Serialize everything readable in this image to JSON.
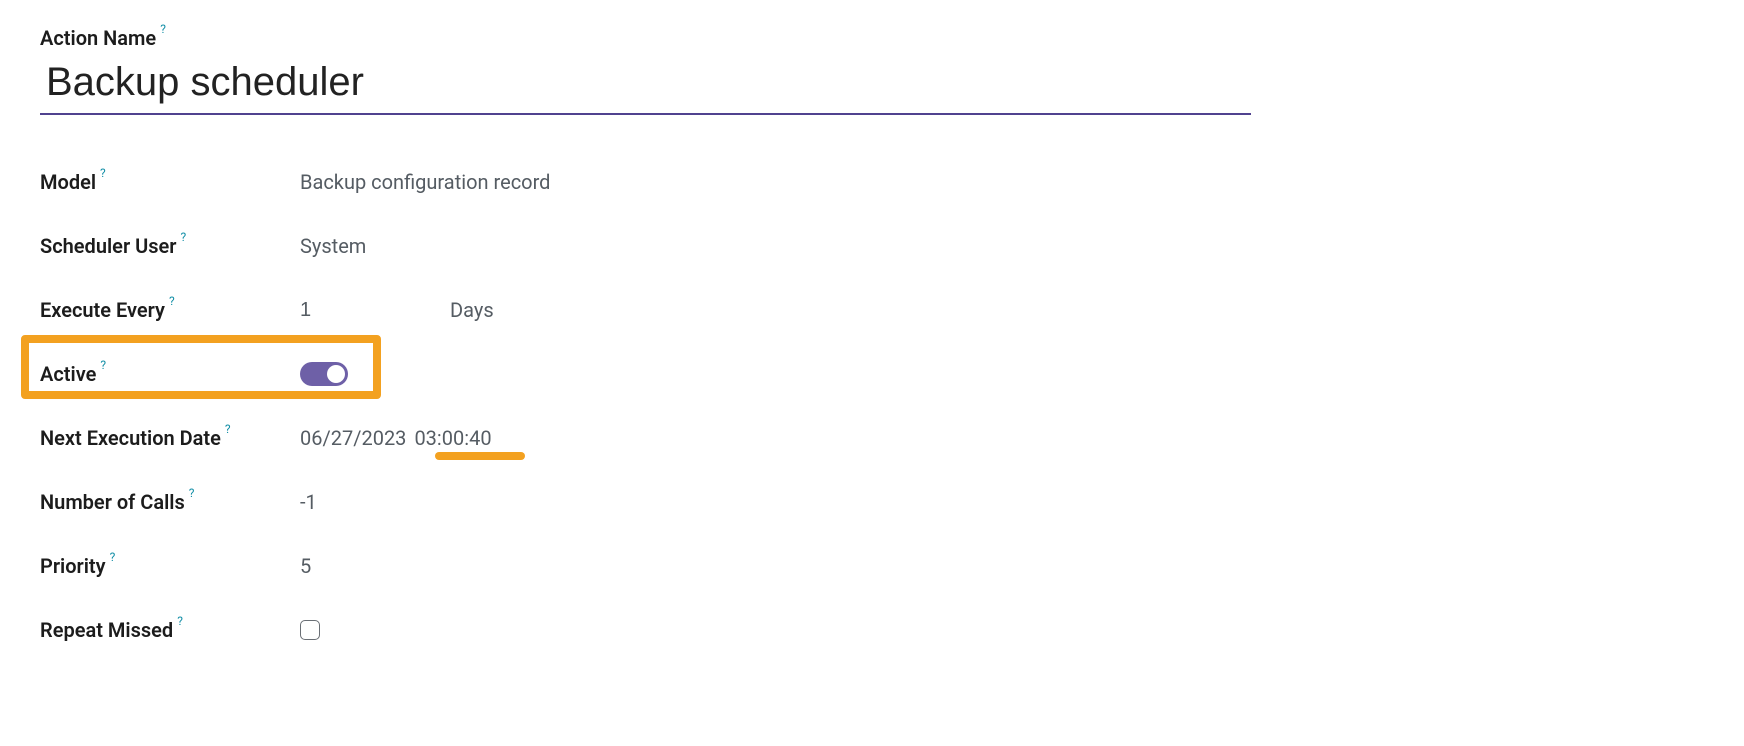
{
  "title_label": "Action Name",
  "title_value": "Backup scheduler",
  "help_glyph": "?",
  "fields": {
    "model": {
      "label": "Model",
      "value": "Backup configuration record"
    },
    "user": {
      "label": "Scheduler User",
      "value": "System"
    },
    "execute_every": {
      "label": "Execute Every",
      "value": "1",
      "unit": "Days"
    },
    "active": {
      "label": "Active",
      "on": true
    },
    "next_exec": {
      "label": "Next Execution Date",
      "date": "06/27/2023",
      "time": "03:00:40"
    },
    "calls": {
      "label": "Number of Calls",
      "value": "-1"
    },
    "priority": {
      "label": "Priority",
      "value": "5"
    },
    "repeat_missed": {
      "label": "Repeat Missed",
      "checked": false
    }
  }
}
